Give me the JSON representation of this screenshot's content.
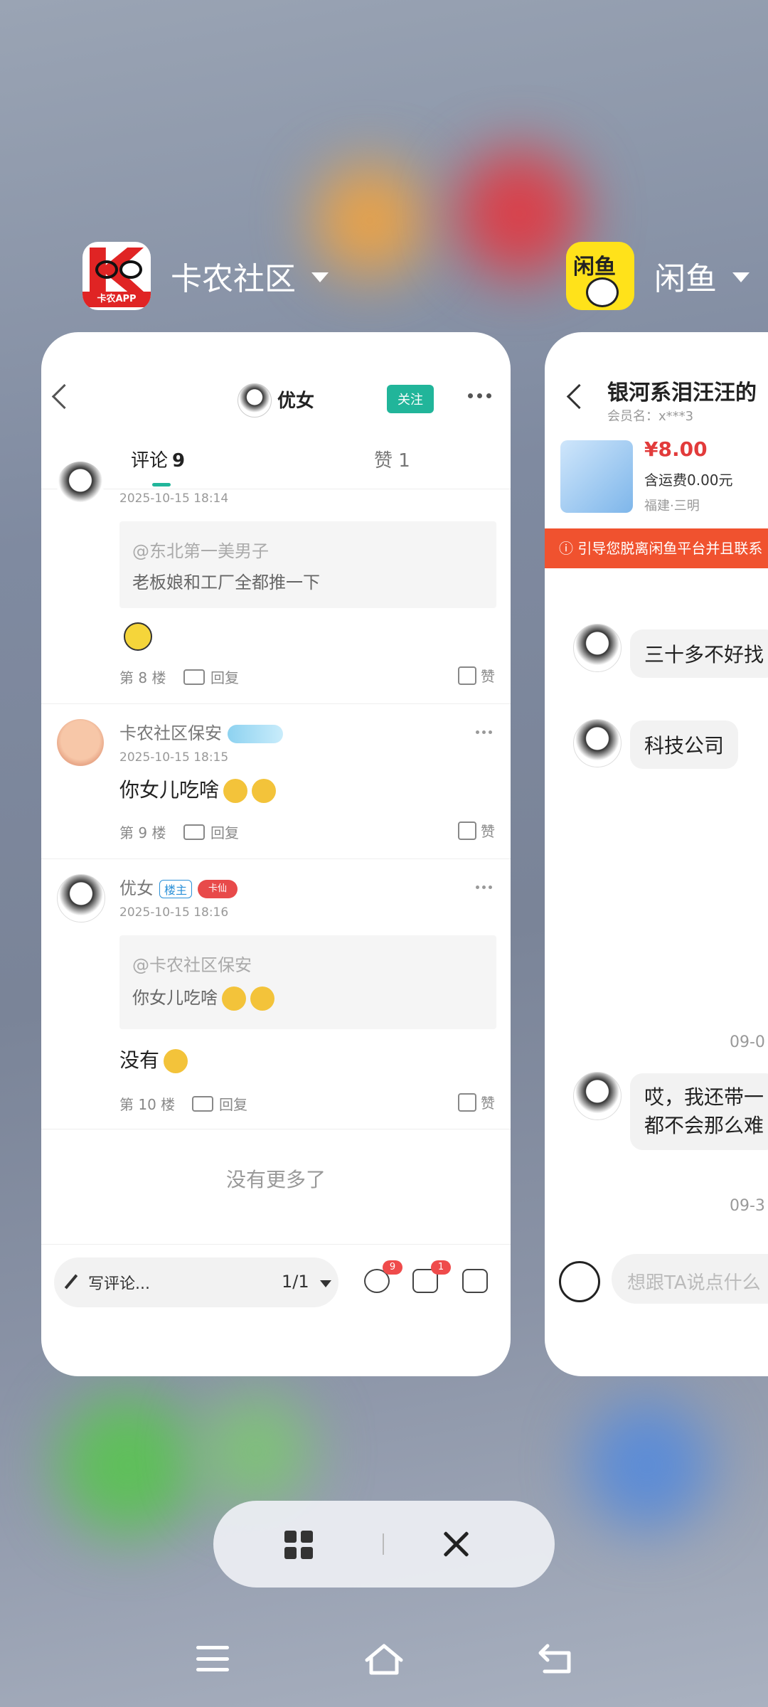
{
  "apps": [
    {
      "name": "卡农社区",
      "icon": "kanong-app-icon",
      "icon_caption": "卡农APP"
    },
    {
      "name": "闲鱼",
      "icon": "xianyu-app-icon",
      "icon_text": "闲鱼"
    }
  ],
  "kanong": {
    "poster_name": "优女",
    "follow_label": "关注",
    "tabs": {
      "comments_label": "评论",
      "comments_count": "9",
      "likes_label": "赞 1"
    },
    "comments": [
      {
        "time": "2025-10-15 18:14",
        "quote_user": "@东北第一美男子",
        "quote_text": "老板娘和工厂全都推一下",
        "floor": "第 8 楼",
        "reply": "回复",
        "like": "赞"
      },
      {
        "name": "卡农社区保安",
        "time": "2025-10-15 18:15",
        "text": "你女儿吃啥",
        "floor": "第 9 楼",
        "reply": "回复",
        "like": "赞"
      },
      {
        "name": "优女",
        "owner_badge": "楼主",
        "level_badge": "卡仙",
        "time": "2025-10-15 18:16",
        "quote_user": "@卡农社区保安",
        "quote_text": "你女儿吃啥",
        "text": "没有",
        "floor": "第 10 楼",
        "reply": "回复",
        "like": "赞"
      }
    ],
    "no_more": "没有更多了",
    "bottom": {
      "write_placeholder": "写评论...",
      "page_indicator": "1/1",
      "comment_badge": "9",
      "like_badge": "1"
    }
  },
  "xianyu": {
    "title": "银河系泪汪汪的",
    "member": "会员名：x***3",
    "price": "¥8.00",
    "shipping": "含运费0.00元",
    "location": "福建·三明",
    "warning": "ⓘ 引导您脱离闲鱼平台并且联系",
    "messages": [
      {
        "text": "三十多不好找"
      },
      {
        "text": "科技公司"
      },
      {
        "text": "哎，我还带一\n都不会那么难"
      }
    ],
    "dates": [
      "09-0",
      "09-3"
    ],
    "input_placeholder": "想跟TA说点什么"
  }
}
